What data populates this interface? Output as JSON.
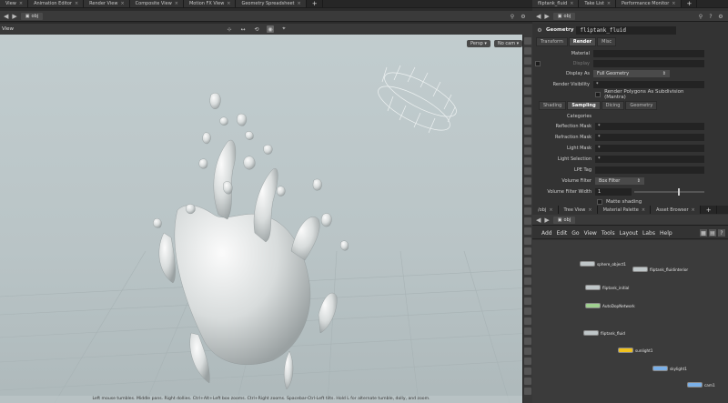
{
  "left_tabs": [
    {
      "label": "View"
    },
    {
      "label": "Animation Editor"
    },
    {
      "label": "Render View"
    },
    {
      "label": "Composite View"
    },
    {
      "label": "Motion FX View"
    },
    {
      "label": "Geometry Spreadsheet"
    }
  ],
  "right_tabs": [
    {
      "label": "fliptank_fluid"
    },
    {
      "label": "Take List"
    },
    {
      "label": "Performance Monitor"
    }
  ],
  "path": {
    "left": "obj",
    "right": "obj"
  },
  "viewport": {
    "label": "View",
    "persp_button": "Persp",
    "camera_button": "No cam",
    "status": "Left mouse tumbles. Middle pans. Right dollies. Ctrl+Alt+Left box zooms. Ctrl+Right zooms. Spacebar-Ctrl-Left tilts. Hold L for alternate tumble, dolly, and zoom."
  },
  "properties": {
    "node_type": "Geometry",
    "node_name": "fliptank_fluid",
    "tabs": [
      "Transform",
      "Render",
      "Misc"
    ],
    "active_tab": "Render",
    "material_label": "Material",
    "display_label": "Display",
    "display_as_label": "Display As",
    "display_as_value": "Full Geometry",
    "render_visibility_label": "Render Visibility",
    "render_visibility_value": "*",
    "subdivision_label": "Render Polygons As Subdivision (Mantra)",
    "subtabs": [
      "Shading",
      "Sampling",
      "Dicing",
      "Geometry"
    ],
    "active_subtab": "Sampling",
    "rows": [
      {
        "label": "Categories",
        "value": ""
      },
      {
        "label": "Reflection Mask",
        "value": "*"
      },
      {
        "label": "Refraction Mask",
        "value": "*"
      },
      {
        "label": "Light Mask",
        "value": "*"
      },
      {
        "label": "Light Selection",
        "value": "*"
      },
      {
        "label": "LPE Tag",
        "value": ""
      }
    ],
    "volume_filter_label": "Volume Filter",
    "volume_filter_value": "Box Filter",
    "volume_filter_width_label": "Volume Filter Width",
    "volume_filter_width_value": "1",
    "volume_filter_width_fraction": 0.62,
    "matte_label": "Matte shading"
  },
  "network": {
    "tabs": [
      "/obj",
      "Tree View",
      "Material Palette",
      "Asset Browser"
    ],
    "path": "obj",
    "menu": [
      "Add",
      "Edit",
      "Go",
      "View",
      "Tools",
      "Layout",
      "Labs",
      "Help"
    ],
    "nodes": [
      {
        "label": "sphere_object1",
        "sub": ""
      },
      {
        "label": "fliptank_fluidinterior",
        "sub": ""
      },
      {
        "label": "fliptank_initial",
        "sub": ""
      },
      {
        "label": "AutoDopNetwork",
        "sub": ""
      },
      {
        "label": "fliptank_fluid",
        "sub": ""
      },
      {
        "label": "sunlight1",
        "sub": ""
      },
      {
        "label": "skylight1",
        "sub": ""
      },
      {
        "label": "cam1",
        "sub": ""
      }
    ]
  },
  "colors": {
    "viewport_bg": "#c2cdcf",
    "panel_bg": "#333333",
    "dop_node": "#9fd08f",
    "light_node": "#f0c21e",
    "camera_node": "#7ab0e8"
  }
}
